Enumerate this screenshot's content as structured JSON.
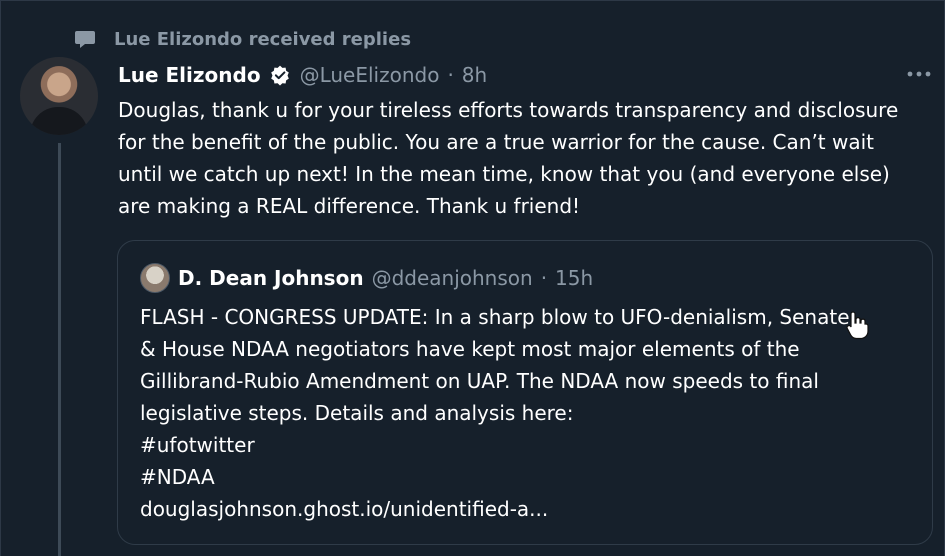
{
  "social_context": {
    "text": "Lue Elizondo received replies",
    "icon": "reply-bubble-icon"
  },
  "tweet": {
    "author_name": "Lue Elizondo",
    "handle": "@LueElizondo",
    "separator": "·",
    "time": "8h",
    "text": "Douglas, thank u for your tireless efforts towards transparency and disclosure for the benefit of the public. You are a true warrior for the cause. Can’t wait until we catch up next! In the mean time, know that you (and everyone else) are making a REAL difference. Thank u friend!",
    "verified_icon": "verified-badge-icon",
    "more_icon": "more-options-icon"
  },
  "quote": {
    "author_name": "D. Dean Johnson",
    "handle": "@ddeanjohnson",
    "separator": "·",
    "time": "15h",
    "lines": [
      "FLASH - CONGRESS UPDATE: In a sharp blow to UFO-denialism, Senate",
      "& House NDAA negotiators have kept most major elements of the",
      "Gillibrand-Rubio Amendment on UAP. The NDAA now speeds to final",
      "legislative steps. Details and analysis here:",
      "#ufotwitter",
      "#NDAA",
      "douglasjohnson.ghost.io/unidentified-a..."
    ]
  },
  "colors": {
    "background": "#16202b",
    "secondary_text": "#8b98a5",
    "border": "#2f3b48"
  }
}
